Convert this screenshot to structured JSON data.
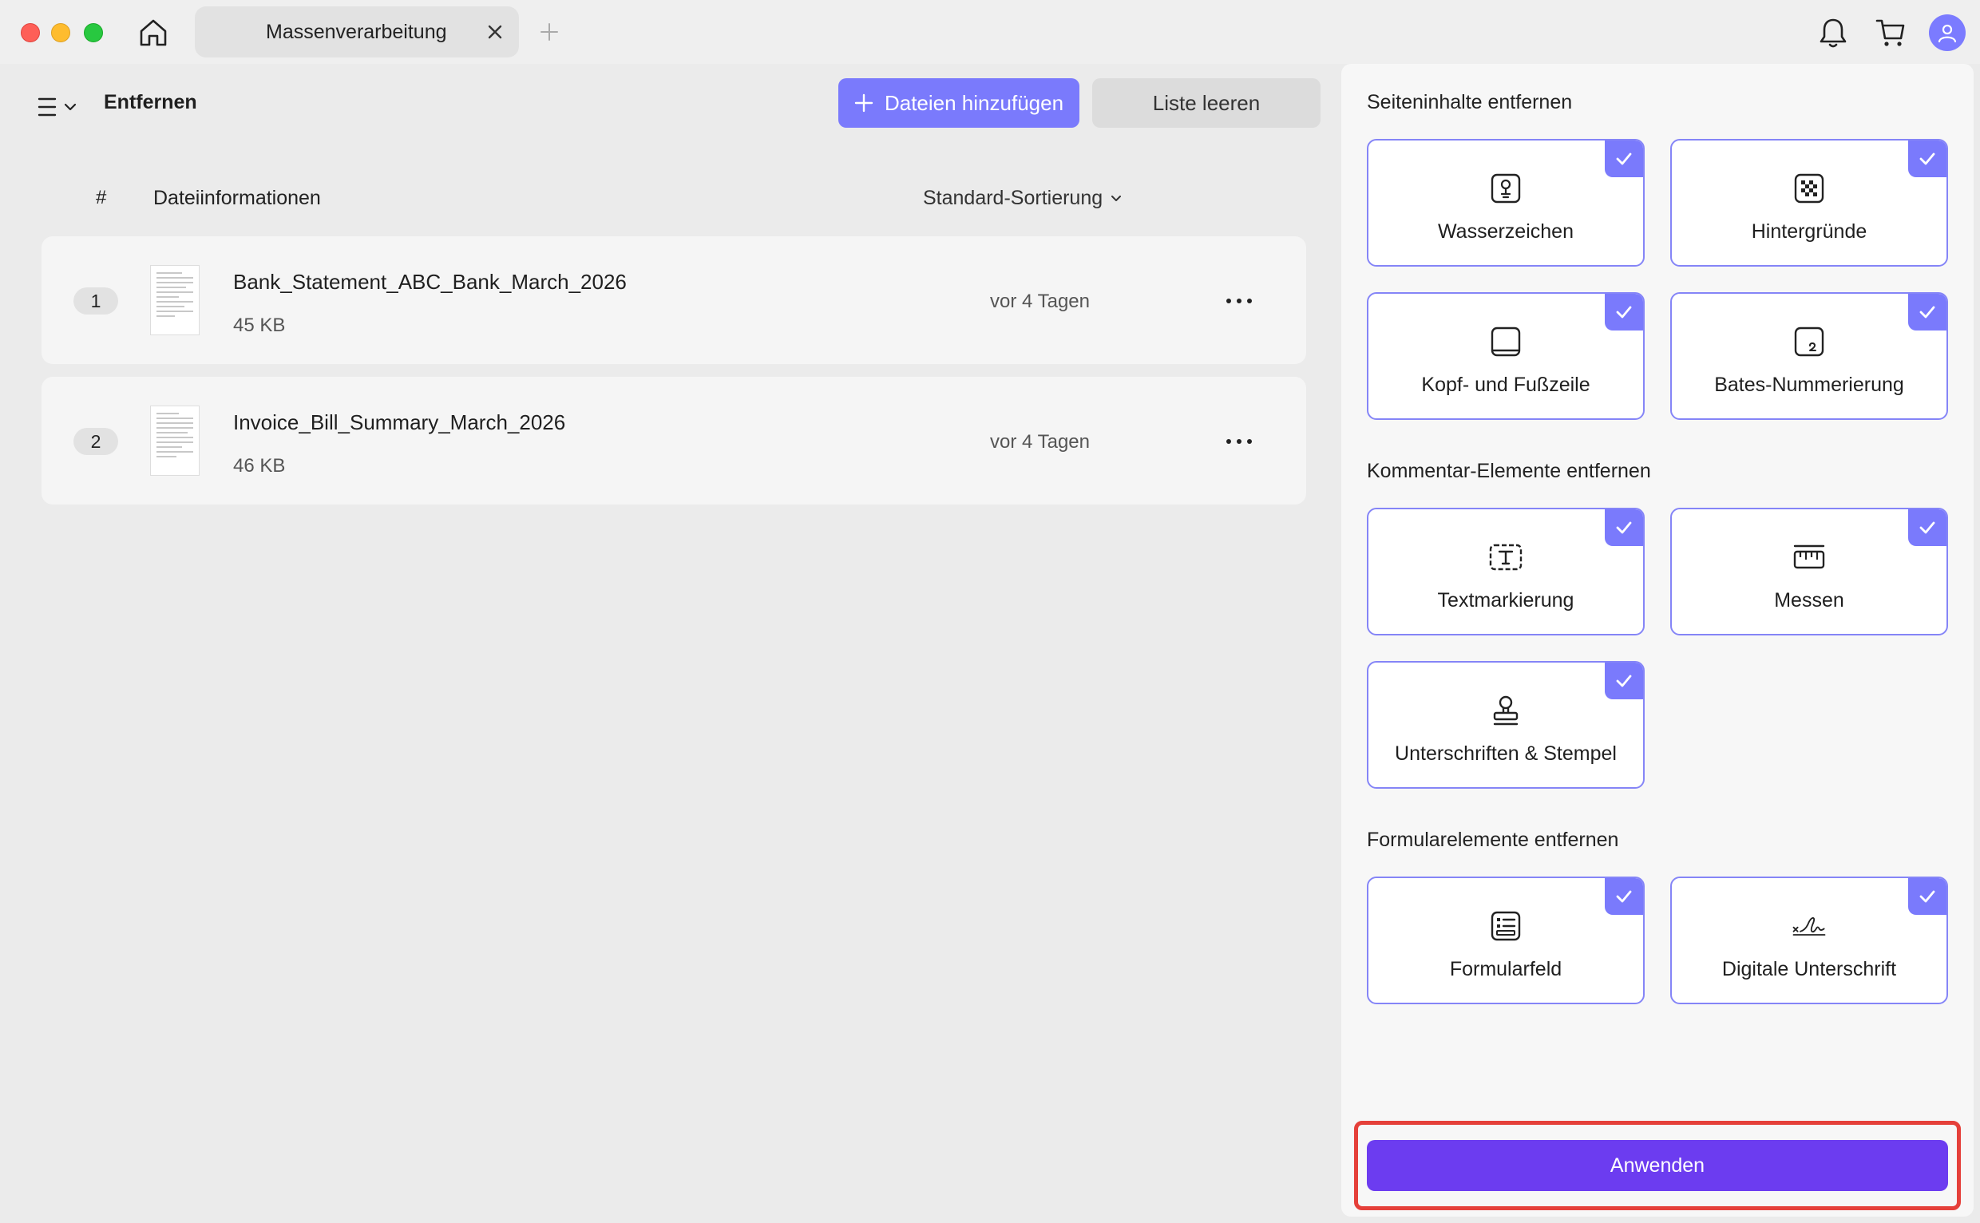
{
  "window": {
    "tab_title": "Massenverarbeitung"
  },
  "toolbar": {
    "panel_title": "Entfernen",
    "add_files_label": "Dateien hinzufügen",
    "clear_list_label": "Liste leeren"
  },
  "file_list": {
    "columns": {
      "number": "#",
      "info": "Dateiinformationen",
      "sort": "Standard-Sortierung"
    },
    "rows": [
      {
        "index": "1",
        "name": "Bank_Statement_ABC_Bank_March_2026",
        "size": "45 KB",
        "date": "vor 4 Tagen"
      },
      {
        "index": "2",
        "name": "Invoice_Bill_Summary_March_2026",
        "size": "46 KB",
        "date": "vor 4 Tagen"
      }
    ]
  },
  "options": {
    "page_content": {
      "title": "Seiteninhalte entfernen",
      "items": [
        {
          "label": "Wasserzeichen",
          "icon": "watermark-icon",
          "checked": true
        },
        {
          "label": "Hintergründe",
          "icon": "background-icon",
          "checked": true
        },
        {
          "label": "Kopf- und Fußzeile",
          "icon": "header-footer-icon",
          "checked": true
        },
        {
          "label": "Bates-Nummerierung",
          "icon": "bates-number-icon",
          "checked": true
        }
      ]
    },
    "comments": {
      "title": "Kommentar-Elemente entfernen",
      "items": [
        {
          "label": "Textmarkierung",
          "icon": "text-markup-icon",
          "checked": true
        },
        {
          "label": "Messen",
          "icon": "measure-icon",
          "checked": true
        },
        {
          "label": "Unterschriften & Stempel",
          "icon": "stamp-icon",
          "checked": true
        }
      ]
    },
    "forms": {
      "title": "Formularelemente entfernen",
      "items": [
        {
          "label": "Formularfeld",
          "icon": "form-field-icon",
          "checked": true
        },
        {
          "label": "Digitale Unterschrift",
          "icon": "digital-signature-icon",
          "checked": true
        }
      ]
    }
  },
  "apply_label": "Anwenden",
  "colors": {
    "accent": "#7a7afc",
    "apply": "#6c3cf0",
    "highlight": "#e5403a"
  }
}
